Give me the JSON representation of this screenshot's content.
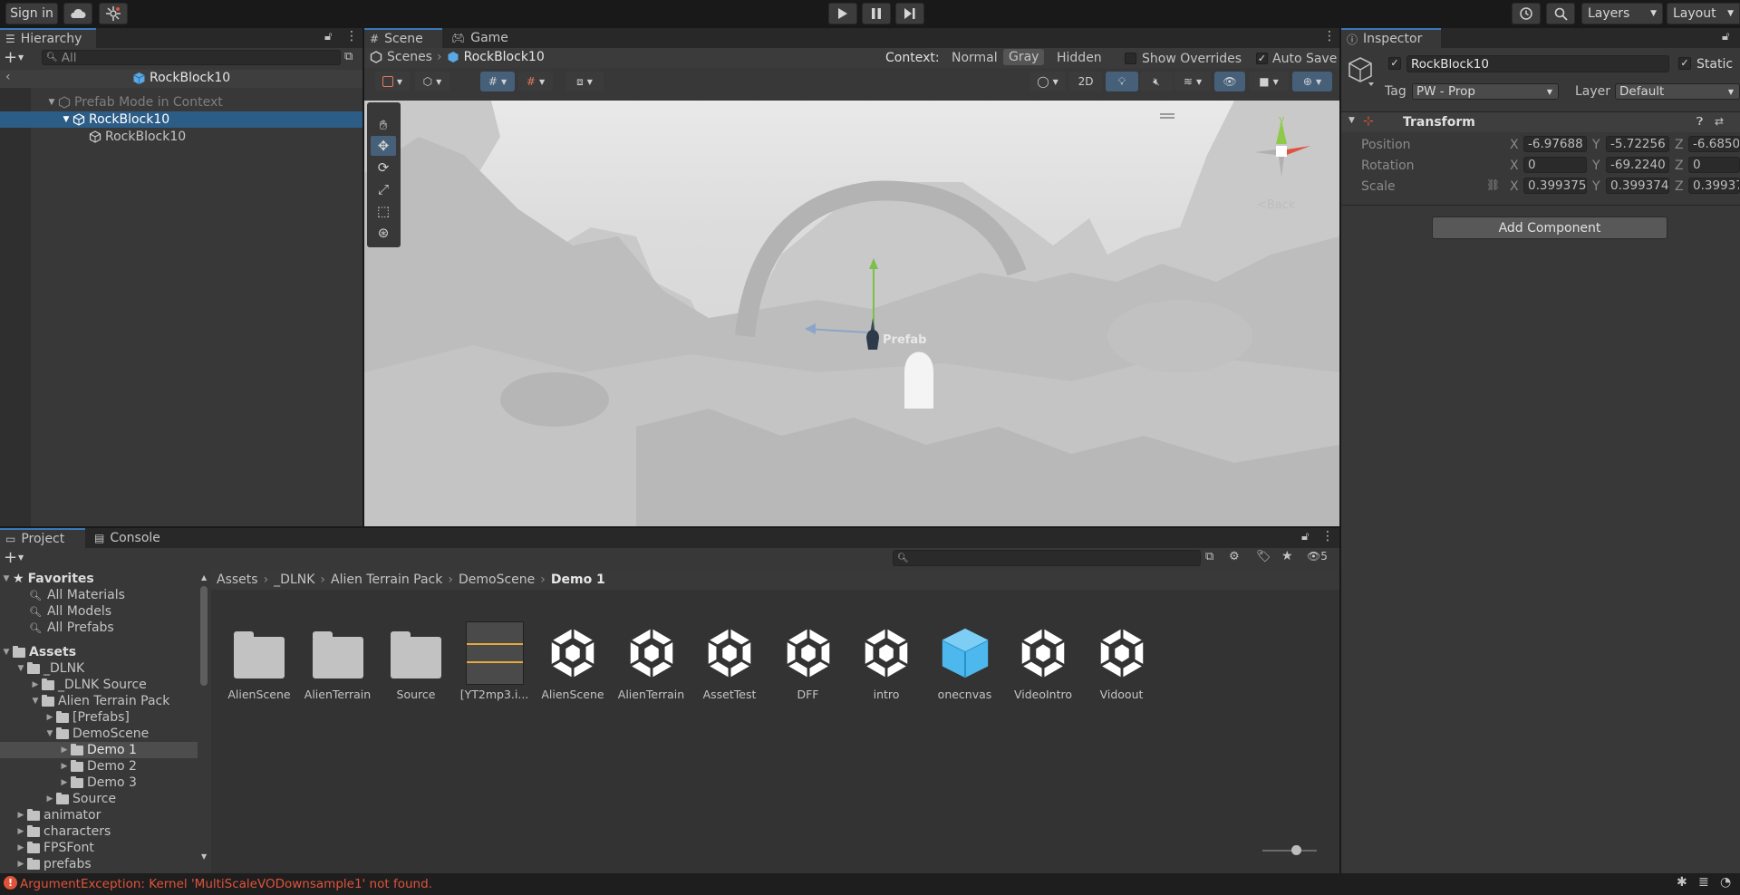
{
  "toolbar": {
    "sign_in": "Sign in",
    "layers": "Layers",
    "layout": "Layout"
  },
  "hierarchy": {
    "tab": "Hierarchy",
    "search_placeholder": "All",
    "root": "RockBlock10",
    "prefab_mode": "Prefab Mode in Context",
    "items": [
      "RockBlock10",
      "RockBlock10"
    ]
  },
  "scene": {
    "tabs": [
      "Scene",
      "Game"
    ],
    "breadcrumb": [
      "Scenes",
      "RockBlock10"
    ],
    "context_label": "Context:",
    "context_options": [
      "Normal",
      "Gray",
      "Hidden"
    ],
    "context_selected": "Gray",
    "show_overrides": "Show Overrides",
    "auto_save": "Auto Save",
    "btn_2d": "2D",
    "object_label": "Prefab",
    "back_label": "<Back",
    "gizmo_y": "y"
  },
  "inspector": {
    "tab": "Inspector",
    "object_name": "RockBlock10",
    "static_label": "Static",
    "tag_label": "Tag",
    "tag_value": "PW - Prop",
    "layer_label": "Layer",
    "layer_value": "Default",
    "component": "Transform",
    "rows": [
      {
        "label": "Position",
        "x": "-6.97688",
        "y": "-5.72256",
        "z": "-6.6850"
      },
      {
        "label": "Rotation",
        "x": "0",
        "y": "-69.2240",
        "z": "0"
      },
      {
        "label": "Scale",
        "x": "0.399375",
        "y": "0.399374",
        "z": "0.39937"
      }
    ],
    "axis_x": "X",
    "axis_y": "Y",
    "axis_z": "Z",
    "add_component": "Add Component"
  },
  "project": {
    "tabs": [
      "Project",
      "Console"
    ],
    "hidden_count": "5",
    "favorites": {
      "title": "Favorites",
      "items": [
        "All Materials",
        "All Models",
        "All Prefabs"
      ]
    },
    "assets_title": "Assets",
    "tree": [
      "_DLNK",
      "_DLNK Source",
      "Alien Terrain Pack",
      "[Prefabs]",
      "DemoScene",
      "Demo 1",
      "Demo 2",
      "Demo 3",
      "Source",
      "animator",
      "characters",
      "FPSFont",
      "prefabs"
    ],
    "breadcrumb": [
      "Assets",
      "_DLNK",
      "Alien Terrain Pack",
      "DemoScene",
      "Demo 1"
    ],
    "assets": [
      {
        "name": "AlienScene",
        "kind": "folder"
      },
      {
        "name": "AlienTerrain",
        "kind": "folder"
      },
      {
        "name": "Source",
        "kind": "folder"
      },
      {
        "name": "[YT2mp3.i...",
        "kind": "audio"
      },
      {
        "name": "AlienScene",
        "kind": "scene"
      },
      {
        "name": "AlienTerrain",
        "kind": "scene"
      },
      {
        "name": "AssetTest",
        "kind": "scene"
      },
      {
        "name": "DFF",
        "kind": "scene"
      },
      {
        "name": "intro",
        "kind": "scene"
      },
      {
        "name": "onecnvas",
        "kind": "prefab"
      },
      {
        "name": "VideoIntro",
        "kind": "scene"
      },
      {
        "name": "Vidoout",
        "kind": "scene"
      }
    ]
  },
  "status": {
    "error": "ArgumentException: Kernel 'MultiScaleVODownsample1' not found."
  },
  "colors": {
    "accent": "#2c5d87",
    "selection": "#2c5d87",
    "error": "#e0533b"
  }
}
